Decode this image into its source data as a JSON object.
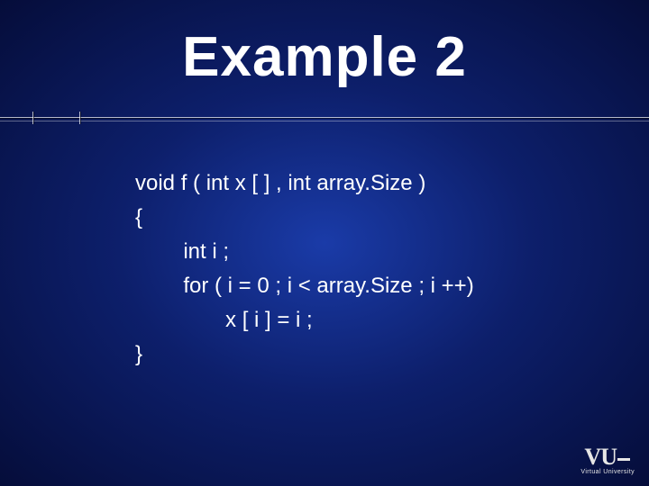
{
  "title": "Example 2",
  "code": {
    "line1": "void f ( int x [ ] , int array.Size )",
    "line2": "{",
    "line3": "        int i ;",
    "line4": "        for ( i = 0 ; i < array.Size ; i ++)",
    "line5": "               x [ i ] = i ;",
    "line6": "}"
  },
  "logo": {
    "main": "VU",
    "sub": "Virtual University"
  }
}
